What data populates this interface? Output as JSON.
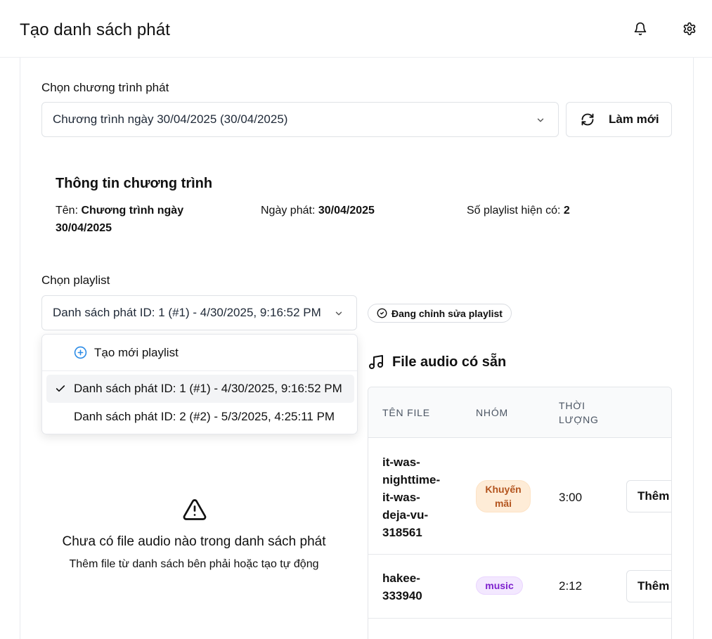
{
  "header": {
    "title": "Tạo danh sách phát",
    "bell_icon": "bell-icon",
    "settings_icon": "gear-icon"
  },
  "program_select": {
    "label": "Chọn chương trình phát",
    "value": "Chương trình ngày 30/04/2025 (30/04/2025)",
    "refresh_label": "Làm mới"
  },
  "program_info": {
    "title": "Thông tin chương trình",
    "name_label": "Tên: ",
    "name_value_line1": "Chương trình ngày",
    "name_value_line2": "30/04/2025",
    "date_label": "Ngày phát: ",
    "date_value": "30/04/2025",
    "count_label": "Số playlist hiện có: ",
    "count_value": "2"
  },
  "playlist_select": {
    "label": "Chọn playlist",
    "value": "Danh sách phát ID: 1 (#1) - 4/30/2025, 9:16:52 PM",
    "editing_badge": "Đang chỉnh sửa playlist",
    "dropdown": {
      "create_new": "Tạo mới playlist",
      "options": [
        {
          "label": "Danh sách phát ID: 1 (#1) - 4/30/2025, 9:16:52 PM",
          "selected": true
        },
        {
          "label": "Danh sách phát ID: 2 (#2) - 5/3/2025, 4:25:11 PM",
          "selected": false
        }
      ]
    }
  },
  "empty_state": {
    "title": "Chưa có file audio nào trong danh sách phát",
    "subtitle": "Thêm file từ danh sách bên phải hoặc tạo tự động"
  },
  "audio_library": {
    "title": "File audio có sẵn",
    "columns": [
      "TÊN FILE",
      "NHÓM",
      "THỜI",
      "LƯỢNG"
    ],
    "rows": [
      {
        "name_lines": [
          "it-was-",
          "nighttime-",
          "it-was-",
          "deja-vu-",
          "318561"
        ],
        "group_lines": [
          "Khuyến",
          "mãi"
        ],
        "duration": "3:00",
        "action": "Thêm"
      },
      {
        "name_lines": [
          "hakee-",
          "333940"
        ],
        "group_lines": [
          "music"
        ],
        "duration": "2:12",
        "action": "Thêm"
      }
    ]
  },
  "colors": {
    "promo_tag_bg": "#feecd7",
    "promo_tag_text": "#b3541e",
    "music_tag_bg": "#f3e8ff",
    "music_tag_text": "#7e22ce",
    "accent_blue": "#2b8be6"
  }
}
